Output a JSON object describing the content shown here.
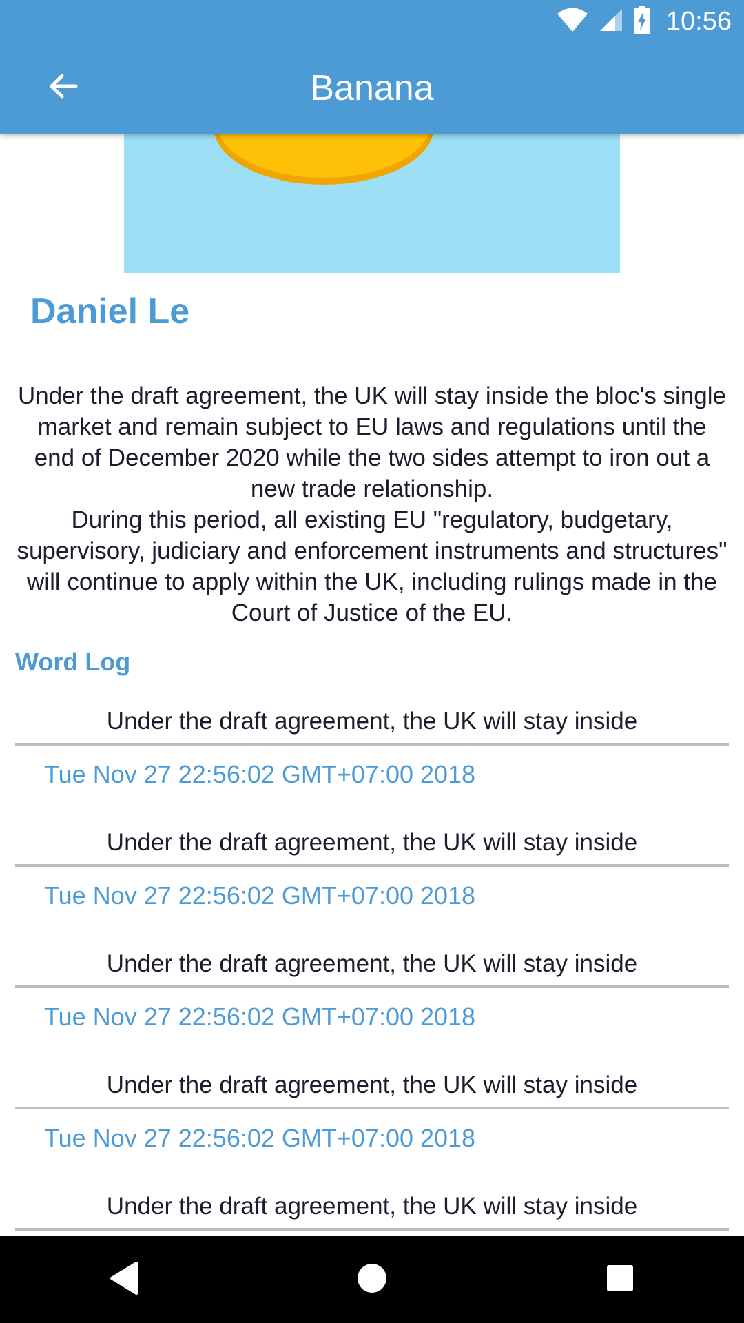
{
  "status_bar": {
    "time": "10:56",
    "icons": [
      "wifi-icon",
      "cell-signal-icon",
      "battery-charging-icon"
    ]
  },
  "app_bar": {
    "title": "Banana",
    "back_icon": "arrow-left-icon"
  },
  "article": {
    "author": "Daniel Le",
    "paragraphs": [
      "Under the draft agreement, the UK will stay inside the bloc's single market and remain subject to EU laws and regulations until the end of December 2020 while the two sides attempt to iron out a new trade relationship.",
      "During this period, all existing EU \"regulatory, budgetary, supervisory, judiciary and enforcement instruments and structures\" will continue to apply within the UK, including rulings made in the Court of Justice of the EU."
    ]
  },
  "word_log": {
    "title": "Word Log",
    "entries": [
      {
        "text": "Under the draft agreement, the UK will stay inside",
        "date": "Tue Nov 27 22:56:02 GMT+07:00 2018"
      },
      {
        "text": "Under the draft agreement, the UK will stay inside",
        "date": "Tue Nov 27 22:56:02 GMT+07:00 2018"
      },
      {
        "text": "Under the draft agreement, the UK will stay inside",
        "date": "Tue Nov 27 22:56:02 GMT+07:00 2018"
      },
      {
        "text": "Under the draft agreement, the UK will stay inside",
        "date": "Tue Nov 27 22:56:02 GMT+07:00 2018"
      },
      {
        "text": "Under the draft agreement, the UK will stay inside",
        "date": ""
      }
    ]
  },
  "nav_bar": {
    "buttons": [
      "back-triangle-icon",
      "home-circle-icon",
      "recents-square-icon"
    ]
  },
  "colors": {
    "primary": "#4c9bd5",
    "image_background": "#9ddff5",
    "banana_yellow": "#ffc107",
    "text": "#1c1c2c",
    "divider": "#bdbdbd"
  }
}
